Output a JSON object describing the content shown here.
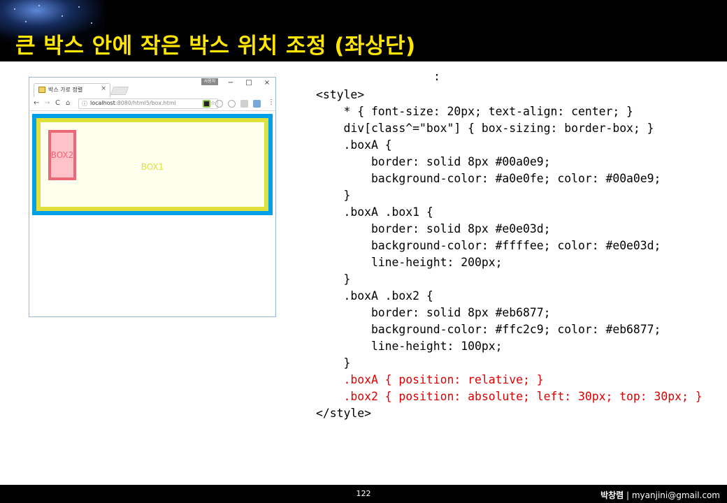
{
  "slide": {
    "title": "큰 박스 안에 작은 박스 위치 조정 (좌상단)",
    "page_number": "122",
    "author_name": "박창렴",
    "author_sep": " | ",
    "author_email": "myanjini@gmail.com",
    "colors": {
      "title": "#ffe600",
      "title_bg": "#000000"
    }
  },
  "browser": {
    "tab_title": "박스 가로 정렬",
    "tab_close": "×",
    "user_badge": "사용자",
    "win_min": "−",
    "win_max": "□",
    "win_close": "×",
    "nav_back": "←",
    "nav_forward": "→",
    "nav_reload": "C",
    "nav_home": "⌂",
    "url_icon": "ⓘ",
    "url_host": "localhost",
    "url_rest": ":8080/html5/box.html",
    "zoom_icon": "⊕",
    "star_icon": "☆",
    "menu": "⋮",
    "box1_label": "BOX1",
    "box2_label": "BOX2"
  },
  "code": {
    "colon": ":",
    "lines": [
      "<style>",
      "    * { font-size: 20px; text-align: center; }",
      "    div[class^=\"box\"] { box-sizing: border-box; }",
      "    .boxA {",
      "        border: solid 8px #00a0e9;",
      "        background-color: #a0e0fe; color: #00a0e9;",
      "    }",
      "    .boxA .box1 {",
      "        border: solid 8px #e0e03d;",
      "        background-color: #ffffee; color: #e0e03d;",
      "        line-height: 200px;",
      "    }",
      "    .boxA .box2 {",
      "        border: solid 8px #eb6877;",
      "        background-color: #ffc2c9; color: #eb6877;",
      "        line-height: 100px;",
      "    }",
      "    .boxA { position: relative; }",
      "    .box2 { position: absolute; left: 30px; top: 30px; }",
      "</style>"
    ],
    "highlight_color": "#e00000"
  }
}
